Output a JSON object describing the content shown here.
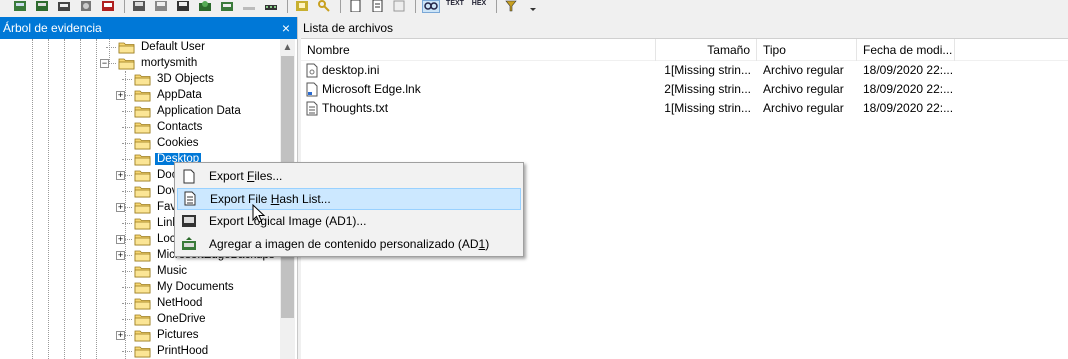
{
  "toolbar": {
    "icons": [
      "add-evidence-icon",
      "image-icon",
      "remove-evidence-icon",
      "disk-icon",
      "export-icon",
      "save-icon",
      "save-disk-icon",
      "print-icon",
      "print-2-icon",
      "capture-icon",
      "clear-icon",
      "memory-icon",
      "tree-icon",
      "key-icon",
      "page-icon",
      "list-icon",
      "gallery-icon",
      "hex-icon",
      "text-icon",
      "hexview-icon",
      "filter-icon",
      "dropdown-icon"
    ],
    "text_label": "TEXT",
    "hex_label": "HEX"
  },
  "left_panel": {
    "title": "Árbol de evidencia",
    "close_glyph": "×"
  },
  "tree": {
    "items": [
      {
        "label": "Default User",
        "expander": ""
      },
      {
        "label": "mortysmith",
        "expander": "−"
      },
      {
        "label": "3D Objects",
        "expander": ""
      },
      {
        "label": "AppData",
        "expander": "+"
      },
      {
        "label": "Application Data",
        "expander": ""
      },
      {
        "label": "Contacts",
        "expander": ""
      },
      {
        "label": "Cookies",
        "expander": ""
      },
      {
        "label": "Desktop",
        "expander": ""
      },
      {
        "label": "Doc",
        "expander": "+"
      },
      {
        "label": "Dov",
        "expander": ""
      },
      {
        "label": "Fav",
        "expander": "+"
      },
      {
        "label": "Link",
        "expander": ""
      },
      {
        "label": "Loc",
        "expander": "+"
      },
      {
        "label": "MicrosoftEdgeBackups",
        "expander": "+"
      },
      {
        "label": "Music",
        "expander": ""
      },
      {
        "label": "My Documents",
        "expander": ""
      },
      {
        "label": "NetHood",
        "expander": ""
      },
      {
        "label": "OneDrive",
        "expander": ""
      },
      {
        "label": "Pictures",
        "expander": "+"
      },
      {
        "label": "PrintHood",
        "expander": ""
      }
    ]
  },
  "right_panel": {
    "title": "Lista de archivos",
    "columns": {
      "name": "Nombre",
      "size": "Tamaño",
      "type": "Tipo",
      "date": "Fecha de modi..."
    },
    "rows": [
      {
        "name": "desktop.ini",
        "size": "1[Missing strin...",
        "type": "Archivo regular",
        "date": "18/09/2020 22:..."
      },
      {
        "name": "Microsoft Edge.lnk",
        "size": "2[Missing strin...",
        "type": "Archivo regular",
        "date": "18/09/2020 22:..."
      },
      {
        "name": "Thoughts.txt",
        "size": "1[Missing strin...",
        "type": "Archivo regular",
        "date": "18/09/2020 22:..."
      }
    ]
  },
  "context_menu": {
    "items": [
      {
        "pre": "Export ",
        "u": "F",
        "post": "iles..."
      },
      {
        "pre": "Export File ",
        "u": "H",
        "post": "ash List..."
      },
      {
        "pre": "Export Lo",
        "u": "g",
        "post": "ical Image (AD1)..."
      },
      {
        "pre": "Agregar a imagen de contenido personalizado (AD",
        "u": "1",
        "post": ")"
      }
    ]
  },
  "colors": {
    "accent": "#0078d7",
    "folder": "#f7d774",
    "menu_hover": "#cce8ff"
  }
}
